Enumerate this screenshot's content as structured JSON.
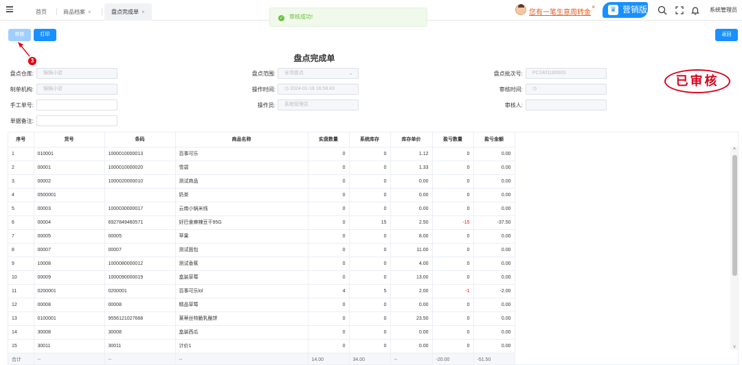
{
  "tabs": [
    {
      "label": "首页",
      "close": ""
    },
    {
      "label": "商品档案",
      "close": "×"
    },
    {
      "label": "盘点完成单",
      "close": "×"
    }
  ],
  "toast": {
    "message": "审核成功!",
    "icon": "✓",
    "color": "#67c23a"
  },
  "promo": {
    "text": "您有一笔生意周转金",
    "close": "×"
  },
  "marketing_button": "营销版",
  "user": "系统管理员",
  "toolbar": {
    "audit": "审核",
    "print": "打印",
    "back": "返回"
  },
  "annotation": {
    "step": "3",
    "color": "#e60012"
  },
  "doc_title": "盘点完成单",
  "form": {
    "warehouse": {
      "label": "盘点仓库:",
      "value": "锅锅小店"
    },
    "range": {
      "label": "盘点范围:",
      "value": "全场盘点"
    },
    "batch": {
      "label": "盘点批次号:",
      "value": "PC2401180003"
    },
    "org": {
      "label": "制单机构:",
      "value": "锅锅小店"
    },
    "op_time": {
      "label": "操作时间:",
      "value": "2024-01-18 16:58:43"
    },
    "audit_time": {
      "label": "审核时间:",
      "value": ""
    },
    "manual_no": {
      "label": "手工单号:",
      "value": ""
    },
    "operator": {
      "label": "操作员:",
      "value": "系统管理员"
    },
    "auditor": {
      "label": "审核人:",
      "value": ""
    },
    "remark": {
      "label": "单据备注:",
      "value": ""
    }
  },
  "stamp": "已审核",
  "table": {
    "headers": [
      "序号",
      "货号",
      "条码",
      "商品名称",
      "实盘数量",
      "系统库存",
      "库存单价",
      "盈亏数量",
      "盈亏金额"
    ],
    "rows": [
      [
        "1",
        "010001",
        "1000010000013",
        "百事可乐",
        "0",
        "0",
        "1.12",
        "0",
        "0.00"
      ],
      [
        "2",
        "00001",
        "1000010000020",
        "雪碧",
        "0",
        "0",
        "1.33",
        "0",
        "0.00"
      ],
      [
        "3",
        "00002",
        "1000020000010",
        "测试商品",
        "0",
        "0",
        "0.00",
        "0",
        "0.00"
      ],
      [
        "4",
        "0500001",
        "",
        "奶茶",
        "0",
        "0",
        "0.00",
        "0",
        "0.00"
      ],
      [
        "5",
        "00003",
        "1000030000017",
        "云南小锅米线",
        "0",
        "0",
        "0.00",
        "0",
        "0.00"
      ],
      [
        "6",
        "00004",
        "6927849460571",
        "好巴食麻辣豆干95G",
        "0",
        "15",
        "2.50",
        "-15",
        "-37.50"
      ],
      [
        "7",
        "00005",
        "00005",
        "苹果",
        "0",
        "0",
        "8.00",
        "0",
        "0.00"
      ],
      [
        "8",
        "00007",
        "00007",
        "测试面包",
        "0",
        "0",
        "11.00",
        "0",
        "0.00"
      ],
      [
        "9",
        "10008",
        "1000080000012",
        "测试香蕉",
        "0",
        "0",
        "4.00",
        "0",
        "0.00"
      ],
      [
        "10",
        "00009",
        "1000090000019",
        "盒装草莓",
        "0",
        "0",
        "13.00",
        "0",
        "0.00"
      ],
      [
        "11",
        "0200001",
        "0200001",
        "百事可乐lol",
        "4",
        "5",
        "2.00",
        "-1",
        "-2.00"
      ],
      [
        "12",
        "00008",
        "00008",
        "精品草莓",
        "0",
        "0",
        "0.00",
        "0",
        "0.00"
      ],
      [
        "13",
        "0100001",
        "9556121027668",
        "莱蒂丝特脆乳酪饼",
        "0",
        "0",
        "23.50",
        "0",
        "0.00"
      ],
      [
        "14",
        "30008",
        "30008",
        "盒装西瓜",
        "0",
        "0",
        "0.00",
        "0",
        "0.00"
      ],
      [
        "15",
        "30011",
        "30011",
        "计价1",
        "0",
        "0",
        "0.00",
        "0",
        "0.00"
      ]
    ],
    "summary": [
      "合计",
      "--",
      "--",
      "--",
      "14.00",
      "34.00",
      "--",
      "-20.00",
      "-51.50"
    ]
  }
}
